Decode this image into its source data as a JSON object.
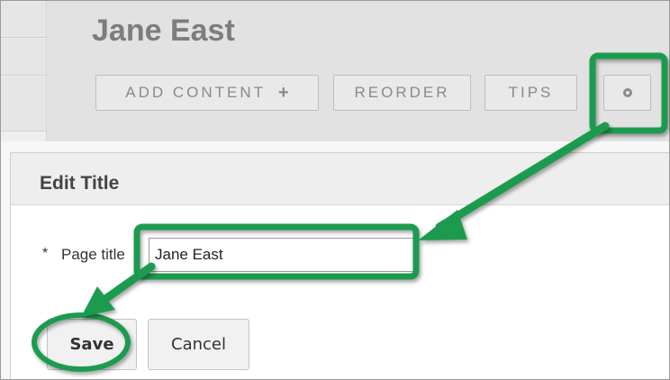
{
  "page": {
    "title": "Jane East"
  },
  "toolbar": {
    "add_content_label": "ADD CONTENT",
    "add_content_plus": "+",
    "reorder_label": "REORDER",
    "tips_label": "TIPS"
  },
  "modal": {
    "title": "Edit Title",
    "required_marker": "*",
    "page_title_label": "Page title",
    "page_title_value": "Jane East",
    "save_label": "Save",
    "cancel_label": "Cancel"
  },
  "annotation": {
    "highlight_color": "#1e9b4f",
    "gear_icon": "gear-icon"
  }
}
